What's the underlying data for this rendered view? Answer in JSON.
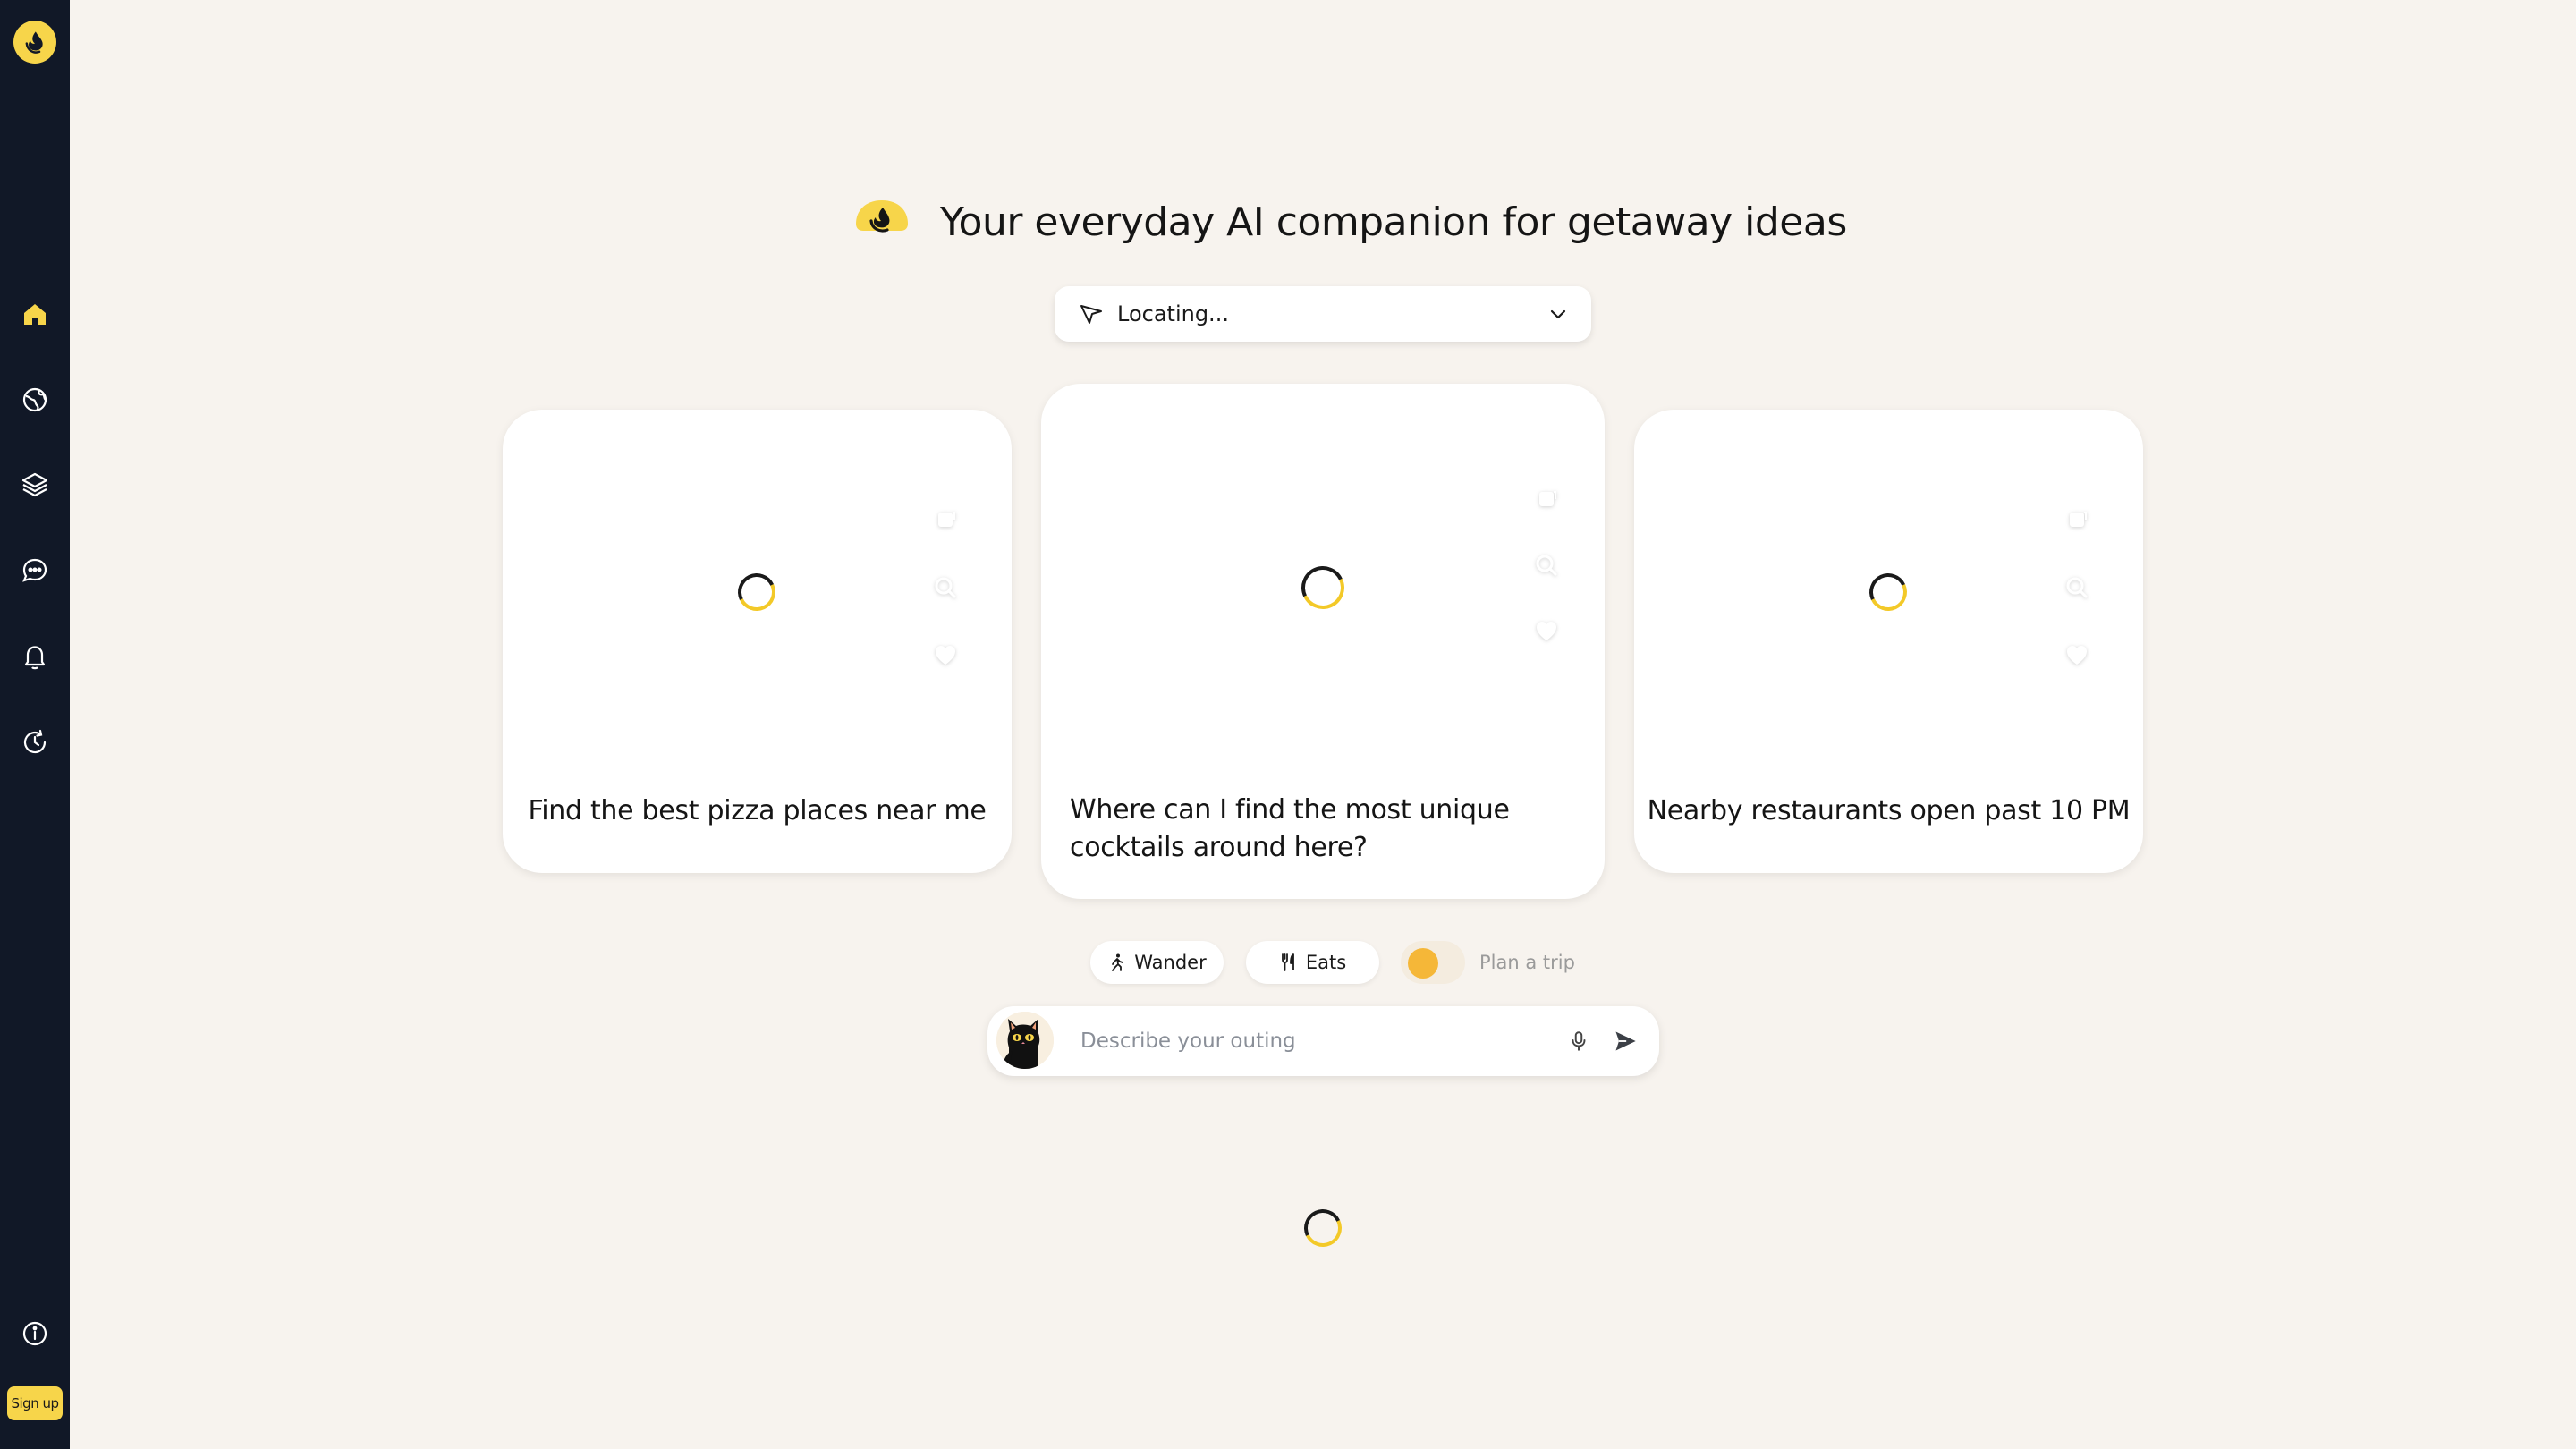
{
  "sidebar": {
    "logo_icon": "yellow-logo-icon",
    "items": [
      {
        "name": "home",
        "icon": "home-icon",
        "active": true
      },
      {
        "name": "explore",
        "icon": "globe-icon"
      },
      {
        "name": "collections",
        "icon": "layers-icon"
      },
      {
        "name": "chats",
        "icon": "chat-bubble-icon"
      },
      {
        "name": "notifications",
        "icon": "bell-icon"
      },
      {
        "name": "history",
        "icon": "history-icon"
      }
    ],
    "info_icon": "info-icon",
    "signup_label": "Sign up"
  },
  "header": {
    "title": "Your everyday AI companion for getaway ideas"
  },
  "location": {
    "value": "Locating..."
  },
  "cards": [
    {
      "text": "Find the best pizza places near me"
    },
    {
      "text": "Where can I find the most unique cocktails around here?"
    },
    {
      "text": "Nearby restaurants open past 10 PM"
    }
  ],
  "modes": {
    "wander_label": "Wander",
    "eats_label": "Eats",
    "plan_trip_label": "Plan a trip"
  },
  "composer": {
    "placeholder": "Describe your outing"
  },
  "colors": {
    "accent": "#f7d54a",
    "toggle_knob": "#f5b738",
    "sidebar_bg": "#111827",
    "page_bg": "#f7f3ee"
  }
}
